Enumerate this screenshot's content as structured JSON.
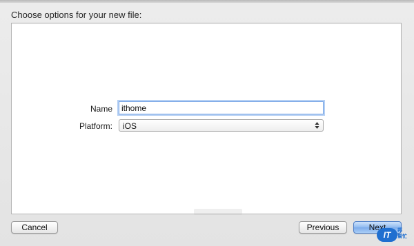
{
  "header": {
    "title": "Choose options for your new file:"
  },
  "form": {
    "name_label": "Name",
    "name_value": "ithome",
    "platform_label": "Platform:",
    "platform_value": "iOS"
  },
  "buttons": {
    "cancel": "Cancel",
    "previous": "Previous",
    "next": "Next"
  },
  "logo": {
    "badge": "IT",
    "side_top": "邦",
    "side_bottom": "幫忙"
  },
  "colors": {
    "accent": "#7cabea",
    "logo": "#1f6fd0"
  }
}
